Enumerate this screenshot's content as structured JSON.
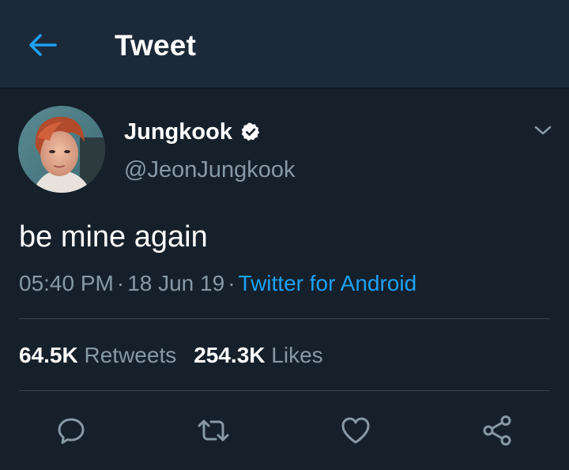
{
  "header": {
    "back_icon": "arrow-left-icon",
    "title": "Tweet"
  },
  "colors": {
    "background": "#15202b",
    "header_background": "#1c2938",
    "accent": "#1da1f2",
    "secondary_text": "#8899a6",
    "divider": "#38444d"
  },
  "tweet": {
    "author": {
      "display_name": "Jungkook",
      "handle": "@JeonJungkook",
      "verified_icon": "verified-badge-icon",
      "avatar_icon": "avatar-photo"
    },
    "menu_icon": "chevron-down-icon",
    "text": "be mine again",
    "time": "05:40 PM",
    "separator": "·",
    "date": "18 Jun 19",
    "source": "Twitter for Android",
    "stats": {
      "retweets_count": "64.5K",
      "retweets_label": "Retweets",
      "likes_count": "254.3K",
      "likes_label": "Likes"
    },
    "actions": [
      {
        "name": "reply",
        "icon": "reply-icon"
      },
      {
        "name": "retweet",
        "icon": "retweet-icon"
      },
      {
        "name": "like",
        "icon": "heart-icon"
      },
      {
        "name": "share",
        "icon": "share-icon"
      }
    ]
  }
}
